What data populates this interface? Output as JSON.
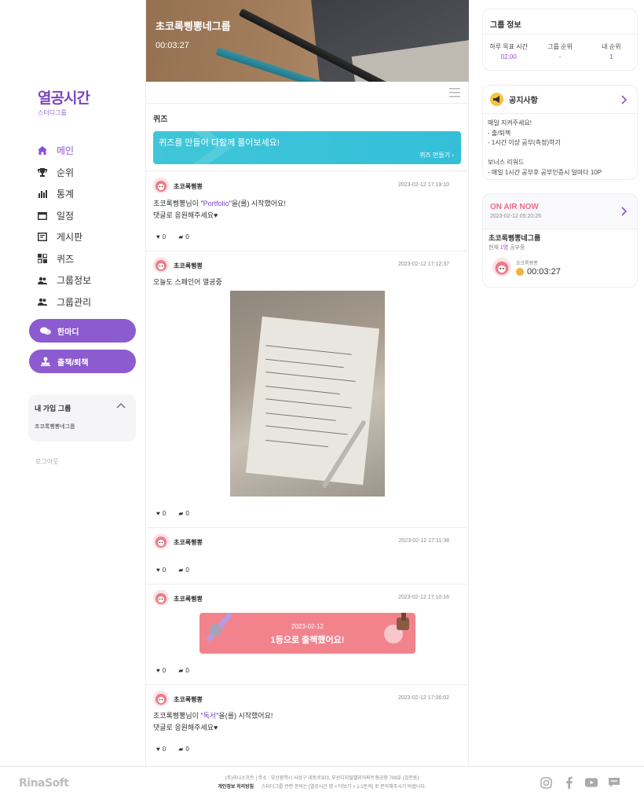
{
  "brand": {
    "name": "열공시간",
    "subtitle": "스터디그룹"
  },
  "nav": [
    {
      "label": "메인",
      "icon": "home-icon",
      "active": true
    },
    {
      "label": "순위",
      "icon": "trophy-icon"
    },
    {
      "label": "통계",
      "icon": "bar-chart-icon"
    },
    {
      "label": "일정",
      "icon": "calendar-icon"
    },
    {
      "label": "게시판",
      "icon": "board-icon"
    },
    {
      "label": "퀴즈",
      "icon": "quiz-icon"
    },
    {
      "label": "그룹정보",
      "icon": "group-icon"
    },
    {
      "label": "그룹관리",
      "icon": "group-manage-icon"
    }
  ],
  "actions": {
    "chat_label": "한마디",
    "checkin_label": "출책/퇴책"
  },
  "my_groups": {
    "title": "내 가입 그룹",
    "items": [
      "초코록삥뽕네그룹"
    ]
  },
  "logout_label": "로그아웃",
  "hero": {
    "title": "초코록삥뽕네그룹",
    "time": "00:03:27"
  },
  "quiz": {
    "title": "퀴즈",
    "banner_text": "퀴즈를 만들어 다함께 풀어보세요!",
    "banner_link": "퀴즈 만들기"
  },
  "posts": [
    {
      "author": "초코록삥뽕",
      "time": "2023-02-12 17:19:10",
      "prefix": "초코록삥뽕님이 \"",
      "highlight": "Portfolio",
      "suffix": "\"을(를) 시작했어요!",
      "line2": "댓글로 응원해주세요♥",
      "likes": "0",
      "comments": "0"
    },
    {
      "author": "초코록삥뽕",
      "time": "2023-02-12 17:12:37",
      "text": "오늘도 스페인어 열공중",
      "likes": "0",
      "comments": "0"
    },
    {
      "author": "초코록삥뽕",
      "time": "2023-02-12 17:11:38",
      "likes": "0",
      "comments": "0"
    },
    {
      "author": "초코록삥뽕",
      "time": "2023-02-12 17:10:16",
      "checkin_date": "2023-02-12",
      "checkin_msg": "1등으로 출첵했어요!",
      "likes": "0",
      "comments": "0"
    },
    {
      "author": "초코록삥뽕",
      "time": "2023-02-12 17:06:02",
      "prefix": "초코록삥뽕님이 \"",
      "highlight": "독서",
      "suffix": "\"을(를) 시작했어요!",
      "line2": "댓글로 응원해주세요♥",
      "likes": "0",
      "comments": "0"
    }
  ],
  "group_info": {
    "title": "그룹 정보",
    "stats": [
      {
        "label": "하루 목표 시간",
        "value": "02:00"
      },
      {
        "label": "그룹 순위",
        "value": "-"
      },
      {
        "label": "내 순위",
        "value": "1"
      }
    ]
  },
  "notice": {
    "title": "공지사항",
    "body": "매일 지켜주세요!\n- 출/퇴첵\n- 1시간 이상 공부(측정)하기\n\n보너스 리워드\n- 매일 1시간 공부후 공부인증시 일마다 10P"
  },
  "onair": {
    "title": "ON AIR NOW",
    "date": "2023-02-12 05:20:26",
    "group": "초코록삥뽕네그룹",
    "count_prefix": "현재 ",
    "count": "1명",
    "count_suffix": " 공부중",
    "user": "초코록삥뽕",
    "time": "00:03:27"
  },
  "footer": {
    "logo": "RinaSoft",
    "address": "(주)리나소프트 | 주소 : 부산광역시 사상구 대동로303, 부산디지털밸리아파트형공장 708호 (감전동)",
    "policy": "개인정보 처리방침",
    "inquiry": "스터디그룹 관련 문의는 [열공시간 앱 > 더보기 > 1:1문의] 로 문의해주시기 바랍니다.",
    "social": [
      "instagram-icon",
      "facebook-icon",
      "youtube-icon",
      "chat-icon"
    ]
  },
  "colors": {
    "accent": "#8c5bd0",
    "quiz_banner": "#34bfd9",
    "checkin_banner": "#f2838d",
    "onair": "#f06a8a"
  }
}
